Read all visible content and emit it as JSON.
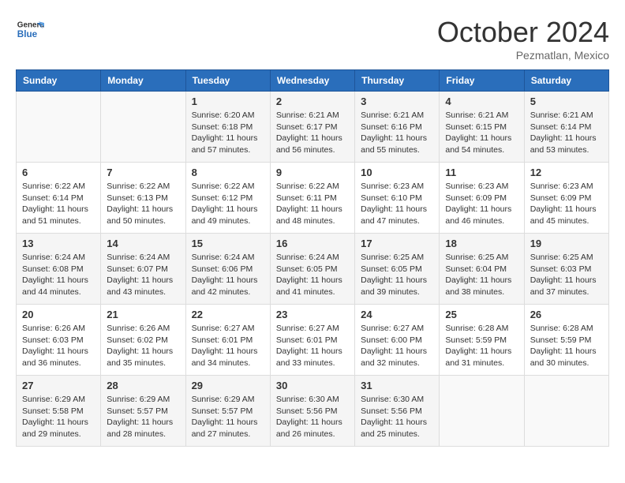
{
  "header": {
    "logo_line1": "General",
    "logo_line2": "Blue",
    "month": "October 2024",
    "location": "Pezmatlan, Mexico"
  },
  "weekdays": [
    "Sunday",
    "Monday",
    "Tuesday",
    "Wednesday",
    "Thursday",
    "Friday",
    "Saturday"
  ],
  "weeks": [
    [
      {
        "day": "",
        "info": ""
      },
      {
        "day": "",
        "info": ""
      },
      {
        "day": "1",
        "info": "Sunrise: 6:20 AM\nSunset: 6:18 PM\nDaylight: 11 hours and 57 minutes."
      },
      {
        "day": "2",
        "info": "Sunrise: 6:21 AM\nSunset: 6:17 PM\nDaylight: 11 hours and 56 minutes."
      },
      {
        "day": "3",
        "info": "Sunrise: 6:21 AM\nSunset: 6:16 PM\nDaylight: 11 hours and 55 minutes."
      },
      {
        "day": "4",
        "info": "Sunrise: 6:21 AM\nSunset: 6:15 PM\nDaylight: 11 hours and 54 minutes."
      },
      {
        "day": "5",
        "info": "Sunrise: 6:21 AM\nSunset: 6:14 PM\nDaylight: 11 hours and 53 minutes."
      }
    ],
    [
      {
        "day": "6",
        "info": "Sunrise: 6:22 AM\nSunset: 6:14 PM\nDaylight: 11 hours and 51 minutes."
      },
      {
        "day": "7",
        "info": "Sunrise: 6:22 AM\nSunset: 6:13 PM\nDaylight: 11 hours and 50 minutes."
      },
      {
        "day": "8",
        "info": "Sunrise: 6:22 AM\nSunset: 6:12 PM\nDaylight: 11 hours and 49 minutes."
      },
      {
        "day": "9",
        "info": "Sunrise: 6:22 AM\nSunset: 6:11 PM\nDaylight: 11 hours and 48 minutes."
      },
      {
        "day": "10",
        "info": "Sunrise: 6:23 AM\nSunset: 6:10 PM\nDaylight: 11 hours and 47 minutes."
      },
      {
        "day": "11",
        "info": "Sunrise: 6:23 AM\nSunset: 6:09 PM\nDaylight: 11 hours and 46 minutes."
      },
      {
        "day": "12",
        "info": "Sunrise: 6:23 AM\nSunset: 6:09 PM\nDaylight: 11 hours and 45 minutes."
      }
    ],
    [
      {
        "day": "13",
        "info": "Sunrise: 6:24 AM\nSunset: 6:08 PM\nDaylight: 11 hours and 44 minutes."
      },
      {
        "day": "14",
        "info": "Sunrise: 6:24 AM\nSunset: 6:07 PM\nDaylight: 11 hours and 43 minutes."
      },
      {
        "day": "15",
        "info": "Sunrise: 6:24 AM\nSunset: 6:06 PM\nDaylight: 11 hours and 42 minutes."
      },
      {
        "day": "16",
        "info": "Sunrise: 6:24 AM\nSunset: 6:05 PM\nDaylight: 11 hours and 41 minutes."
      },
      {
        "day": "17",
        "info": "Sunrise: 6:25 AM\nSunset: 6:05 PM\nDaylight: 11 hours and 39 minutes."
      },
      {
        "day": "18",
        "info": "Sunrise: 6:25 AM\nSunset: 6:04 PM\nDaylight: 11 hours and 38 minutes."
      },
      {
        "day": "19",
        "info": "Sunrise: 6:25 AM\nSunset: 6:03 PM\nDaylight: 11 hours and 37 minutes."
      }
    ],
    [
      {
        "day": "20",
        "info": "Sunrise: 6:26 AM\nSunset: 6:03 PM\nDaylight: 11 hours and 36 minutes."
      },
      {
        "day": "21",
        "info": "Sunrise: 6:26 AM\nSunset: 6:02 PM\nDaylight: 11 hours and 35 minutes."
      },
      {
        "day": "22",
        "info": "Sunrise: 6:27 AM\nSunset: 6:01 PM\nDaylight: 11 hours and 34 minutes."
      },
      {
        "day": "23",
        "info": "Sunrise: 6:27 AM\nSunset: 6:01 PM\nDaylight: 11 hours and 33 minutes."
      },
      {
        "day": "24",
        "info": "Sunrise: 6:27 AM\nSunset: 6:00 PM\nDaylight: 11 hours and 32 minutes."
      },
      {
        "day": "25",
        "info": "Sunrise: 6:28 AM\nSunset: 5:59 PM\nDaylight: 11 hours and 31 minutes."
      },
      {
        "day": "26",
        "info": "Sunrise: 6:28 AM\nSunset: 5:59 PM\nDaylight: 11 hours and 30 minutes."
      }
    ],
    [
      {
        "day": "27",
        "info": "Sunrise: 6:29 AM\nSunset: 5:58 PM\nDaylight: 11 hours and 29 minutes."
      },
      {
        "day": "28",
        "info": "Sunrise: 6:29 AM\nSunset: 5:57 PM\nDaylight: 11 hours and 28 minutes."
      },
      {
        "day": "29",
        "info": "Sunrise: 6:29 AM\nSunset: 5:57 PM\nDaylight: 11 hours and 27 minutes."
      },
      {
        "day": "30",
        "info": "Sunrise: 6:30 AM\nSunset: 5:56 PM\nDaylight: 11 hours and 26 minutes."
      },
      {
        "day": "31",
        "info": "Sunrise: 6:30 AM\nSunset: 5:56 PM\nDaylight: 11 hours and 25 minutes."
      },
      {
        "day": "",
        "info": ""
      },
      {
        "day": "",
        "info": ""
      }
    ]
  ]
}
